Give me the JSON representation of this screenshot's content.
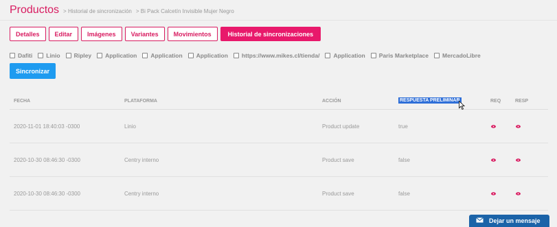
{
  "header": {
    "title": "Productos",
    "crumb1": "> Historial de sincronización",
    "crumb2": "> Bi Pack Calcetín Invisible Mujer Negro"
  },
  "tabs": [
    {
      "label": "Detalles"
    },
    {
      "label": "Editar"
    },
    {
      "label": "Imágenes"
    },
    {
      "label": "Variantes"
    },
    {
      "label": "Movimientos"
    },
    {
      "label": "Historial de sincronizaciones"
    }
  ],
  "platforms": [
    "Dafiti",
    "Linio",
    "Ripley",
    "Application",
    "Application",
    "Application",
    "https://www.mikes.cl/tienda/",
    "Application",
    "Paris Marketplace",
    "MercadoLibre"
  ],
  "sync_label": "Sincronizar",
  "table": {
    "headers": {
      "fecha": "FECHA",
      "plataforma": "PLATAFORMA",
      "accion": "ACCIÓN",
      "respuesta": "RESPUESTA PRELIMINAR",
      "req": "REQ",
      "resp": "RESP"
    },
    "rows": [
      {
        "fecha": "2020-11-01 18:40:03 -0300",
        "plataforma": "Linio",
        "accion": "Product update",
        "respuesta": "true"
      },
      {
        "fecha": "2020-10-30 08:46:30 -0300",
        "plataforma": "Centry interno",
        "accion": "Product save",
        "respuesta": "false"
      },
      {
        "fecha": "2020-10-30 08:46:30 -0300",
        "plataforma": "Centry interno",
        "accion": "Product save",
        "respuesta": "false"
      }
    ]
  },
  "chat_label": "Dejar un mensaje",
  "colors": {
    "brand": "#d81b60",
    "sync": "#1e9bf0",
    "chat": "#1b63a8"
  },
  "icons": {
    "eye": "eye-icon",
    "cursor": "mouse-pointer-icon",
    "envelope": "envelope-icon"
  }
}
